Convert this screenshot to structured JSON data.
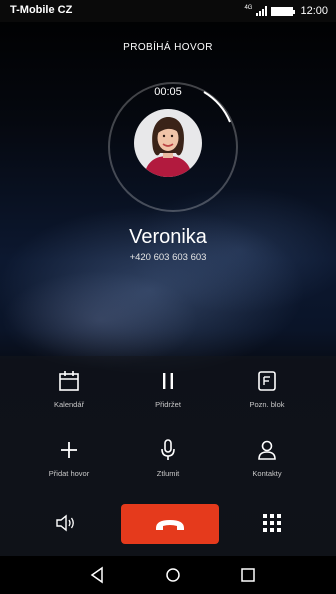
{
  "status_bar": {
    "carrier": "T-Mobile CZ",
    "time": "12:00",
    "network": "4G"
  },
  "call": {
    "status_title": "PROBÍHÁ HOVOR",
    "timer": "00:05",
    "contact_name": "Veronika",
    "contact_number": "+420 603 603 603"
  },
  "actions": [
    {
      "label": "Kalendář",
      "icon": "calendar-icon"
    },
    {
      "label": "Přidržet",
      "icon": "pause-icon"
    },
    {
      "label": "Pozn. blok",
      "icon": "notepad-icon"
    },
    {
      "label": "Přidat hovor",
      "icon": "plus-icon"
    },
    {
      "label": "Ztlumit",
      "icon": "microphone-icon"
    },
    {
      "label": "Kontakty",
      "icon": "person-icon"
    }
  ],
  "controls": {
    "speaker_icon": "speaker-icon",
    "end_call_icon": "hang-up-icon",
    "dialpad_icon": "dialpad-icon",
    "end_call_color": "#e53a1c"
  },
  "navigation": [
    "back-icon",
    "home-icon",
    "recents-icon"
  ]
}
